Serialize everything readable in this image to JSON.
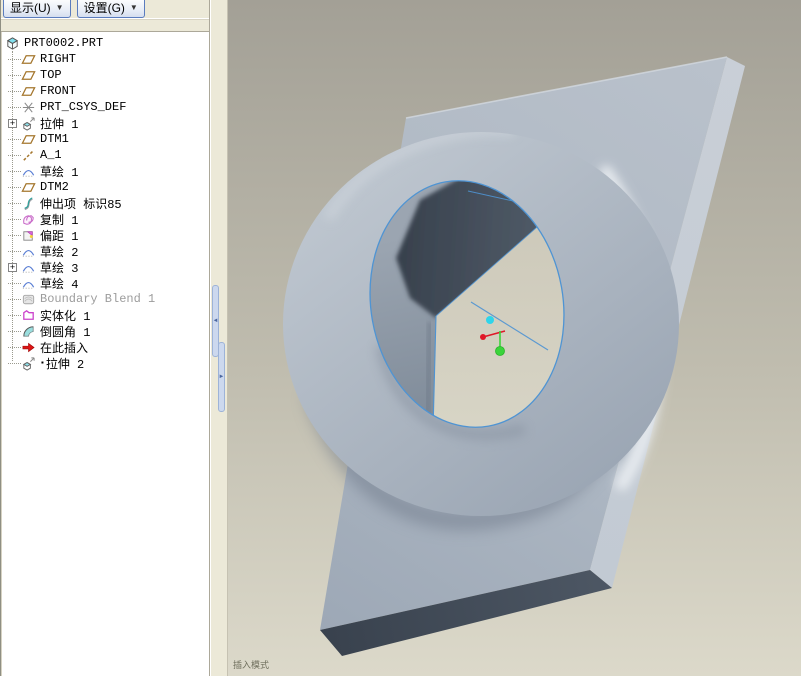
{
  "toolbar": {
    "show_label": "显示(U)",
    "settings_label": "设置(G)",
    "dropdown_glyph": "▼"
  },
  "model_tree": {
    "expand_glyph": "+",
    "items": [
      {
        "label": "PRT0002.PRT",
        "icon": "part",
        "indent": 0
      },
      {
        "label": "RIGHT",
        "icon": "datum-plane",
        "indent": 1
      },
      {
        "label": "TOP",
        "icon": "datum-plane",
        "indent": 1
      },
      {
        "label": "FRONT",
        "icon": "datum-plane",
        "indent": 1
      },
      {
        "label": "PRT_CSYS_DEF",
        "icon": "csys",
        "indent": 1
      },
      {
        "label": "拉伸 1",
        "icon": "extrude",
        "indent": 1,
        "expandable": true
      },
      {
        "label": "DTM1",
        "icon": "datum-plane",
        "indent": 1
      },
      {
        "label": "A_1",
        "icon": "axis",
        "indent": 1
      },
      {
        "label": "草绘 1",
        "icon": "sketch",
        "indent": 1
      },
      {
        "label": "DTM2",
        "icon": "datum-plane",
        "indent": 1
      },
      {
        "label": "伸出项 标识85",
        "icon": "protrusion",
        "indent": 1
      },
      {
        "label": "复制 1",
        "icon": "copy",
        "indent": 1
      },
      {
        "label": "偏距 1",
        "icon": "offset",
        "indent": 1
      },
      {
        "label": "草绘 2",
        "icon": "sketch",
        "indent": 1
      },
      {
        "label": "草绘 3",
        "icon": "sketch",
        "indent": 1,
        "expandable": true
      },
      {
        "label": "草绘 4",
        "icon": "sketch",
        "indent": 1
      },
      {
        "label": "Boundary Blend 1",
        "icon": "boundary-blend",
        "indent": 1,
        "grayed": true
      },
      {
        "label": "实体化 1",
        "icon": "solidify",
        "indent": 1
      },
      {
        "label": "倒圆角 1",
        "icon": "round",
        "indent": 1
      },
      {
        "label": "在此插入",
        "icon": "insert-here",
        "indent": 1
      },
      {
        "label": "拉伸 2",
        "icon": "extrude",
        "indent": 1,
        "prefix": "▪"
      }
    ]
  },
  "sash": {
    "collapse_glyph": "◄",
    "expand_glyph": "►"
  },
  "viewport": {
    "status_text": "插入模式",
    "colors": {
      "bg_top": "#a3a096",
      "bg_bottom": "#dcd9ca",
      "part_face": "#aeb8c4",
      "part_dark_face": "#3c4652",
      "edge_blue": "#4f94d3",
      "datum_cyan": "#2fd4ea",
      "datum_red": "#e01828",
      "datum_green": "#3bd43b",
      "panel_bg": "#ece9d8",
      "grayed_text": "#9c9c9c"
    }
  }
}
